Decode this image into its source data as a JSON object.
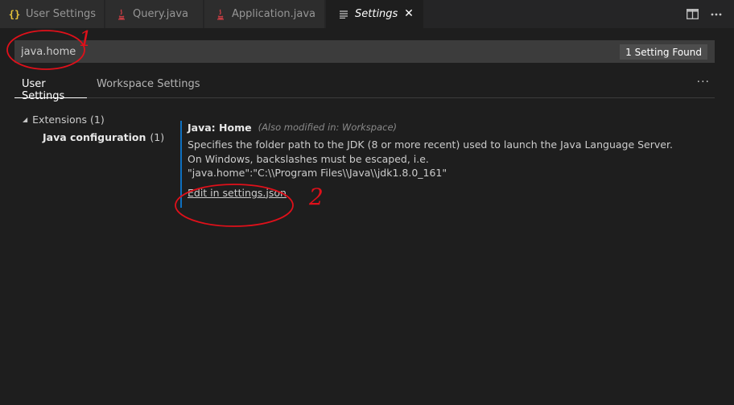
{
  "tabs": [
    {
      "label": "User Settings",
      "icon": "json-braces-icon"
    },
    {
      "label": "Query.java",
      "icon": "java-icon"
    },
    {
      "label": "Application.java",
      "icon": "java-icon"
    },
    {
      "label": "Settings",
      "icon": "lines-icon",
      "active": true
    }
  ],
  "tab_close_glyph": "✕",
  "search": {
    "value": "java.home",
    "result_count": "1 Setting Found"
  },
  "settings_tabs": {
    "user": "User Settings",
    "workspace": "Workspace Settings",
    "more": "···"
  },
  "tree": {
    "extensions": "Extensions (1)",
    "java_config_label": "Java configuration",
    "java_config_count": "(1)"
  },
  "setting": {
    "title": "Java: Home",
    "modified_note": "(Also modified in: Workspace)",
    "description_lines": [
      "Specifies the folder path to the JDK (8 or more recent) used to launch the Java Language Server.",
      "On Windows, backslashes must be escaped, i.e.",
      "\"java.home\":\"C:\\\\Program Files\\\\Java\\\\jdk1.8.0_161\""
    ],
    "edit_link": "Edit in settings.json"
  },
  "annotations": {
    "step1": "1",
    "step2": "2",
    "color": "#e0101a"
  },
  "colors": {
    "background": "#1e1e1e",
    "tabbar": "#252526",
    "accent_border": "#0e70c0"
  }
}
